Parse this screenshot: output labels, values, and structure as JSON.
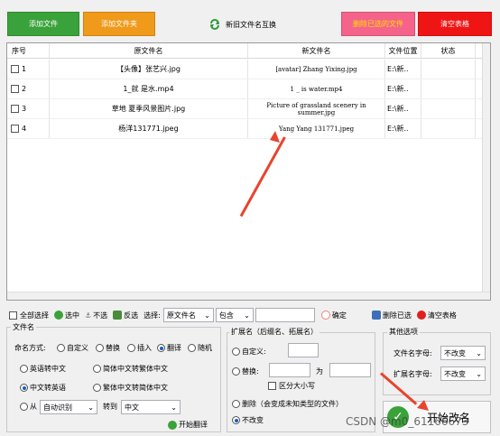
{
  "top_buttons": {
    "add_file": "添加文件",
    "add_folder": "添加文件夹",
    "swap": "新旧文件名互换",
    "delete_selected": "删除已选的文件",
    "clear_table": "清空表格"
  },
  "table": {
    "headers": [
      "序号",
      "原文件名",
      "新文件名",
      "文件位置",
      "状态"
    ],
    "rows": [
      {
        "index": "1",
        "original": "【头像】张艺兴.jpg",
        "new": "[avatar] Zhang Yixing.jpg",
        "location": "E:\\新..",
        "status": ""
      },
      {
        "index": "2",
        "original": "1_就 是水.mp4",
        "new": "1 _ is water.mp4",
        "location": "E:\\新..",
        "status": ""
      },
      {
        "index": "3",
        "original": "草地 夏季风景图片.jpg",
        "new": "Picture of grassland scenery in summer.jpg",
        "location": "E:\\新..",
        "status": ""
      },
      {
        "index": "4",
        "original": "杨洋131771.jpeg",
        "new": "Yang Yang 131771.jpeg",
        "location": "E:\\新..",
        "status": ""
      }
    ]
  },
  "toolbar": {
    "select_all": "全部选择",
    "select": "选中",
    "deselect": "不选",
    "invert": "反选",
    "choose_label": "选择:",
    "field_select": "原文件名",
    "contain_select": "包含",
    "confirm": "确定",
    "delete_selected": "删除已选",
    "clear_table": "清空表格"
  },
  "filename_panel": {
    "title": "文件名",
    "mode_label": "命名方式:",
    "modes": [
      "自定义",
      "替换",
      "插入",
      "翻译",
      "随机"
    ],
    "selected_mode": "翻译",
    "en_to_zh": "英语转中文",
    "simp_to_trad": "简体中文转繁体中文",
    "zh_to_en": "中文转英语",
    "trad_to_simp": "繁体中文转简体中文",
    "from_label": "从",
    "from_value": "自动识别",
    "to_label": "转到",
    "to_value": "中文",
    "start_translate": "开始翻译"
  },
  "ext_panel": {
    "title": "扩展名（后缀名、拓展名）",
    "custom": "自定义:",
    "replace": "替换:",
    "to": "为",
    "case_sensitive": "区分大小写",
    "delete": "删除（会变成未知类型的文件）",
    "unchanged": "不改变"
  },
  "other_panel": {
    "title": "其他选项",
    "filename_case_label": "文件名字母:",
    "filename_case_value": "不改变",
    "ext_case_label": "扩展名字母:",
    "ext_case_value": "不改变"
  },
  "start_button": "开始改名",
  "watermark": "CSDN @m0_61166673",
  "colors": {
    "green": "#3aa23a",
    "orange": "#ef9a1a",
    "pink": "#f5638a",
    "red": "#f01515",
    "arrow": "#e8442e"
  }
}
